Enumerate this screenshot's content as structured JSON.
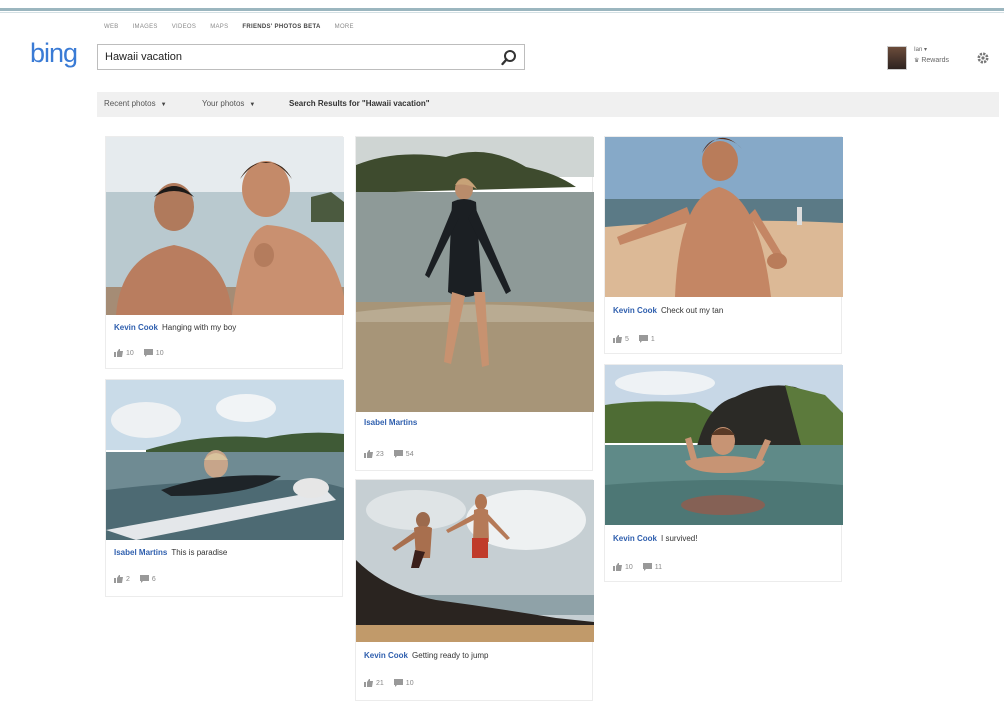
{
  "nav": [
    "WEB",
    "IMAGES",
    "VIDEOS",
    "MAPS",
    "FRIENDS' PHOTOS BETA",
    "MORE"
  ],
  "nav_active": 4,
  "logo": "bing",
  "search": {
    "value": "Hawaii vacation",
    "icon": "search-icon"
  },
  "user": {
    "name": "Ian ▾",
    "rewards": "Rewards",
    "settings_icon": "gear-icon"
  },
  "subbar": {
    "recent": "Recent photos",
    "yours": "Your photos",
    "results": "Search Results for \"Hawaii vacation\""
  },
  "posts": [
    {
      "author": "Kevin Cook",
      "caption": "Hanging with my boy",
      "likes": "10",
      "comments": "10"
    },
    {
      "author": "Isabel Martins",
      "caption": "This is paradise",
      "likes": "2",
      "comments": "6"
    },
    {
      "author": "Isabel Martins",
      "caption": "",
      "likes": "23",
      "comments": "54"
    },
    {
      "author": "Kevin Cook",
      "caption": "Getting ready to jump",
      "likes": "21",
      "comments": "10"
    },
    {
      "author": "Kevin Cook",
      "caption": "Check out my tan",
      "likes": "5",
      "comments": "1"
    },
    {
      "author": "Kevin Cook",
      "caption": "I survived!",
      "likes": "10",
      "comments": "11"
    }
  ],
  "colors": {
    "link": "#2f5fae",
    "logo": "#3a7bd5",
    "subbar": "#f0f0f0"
  }
}
